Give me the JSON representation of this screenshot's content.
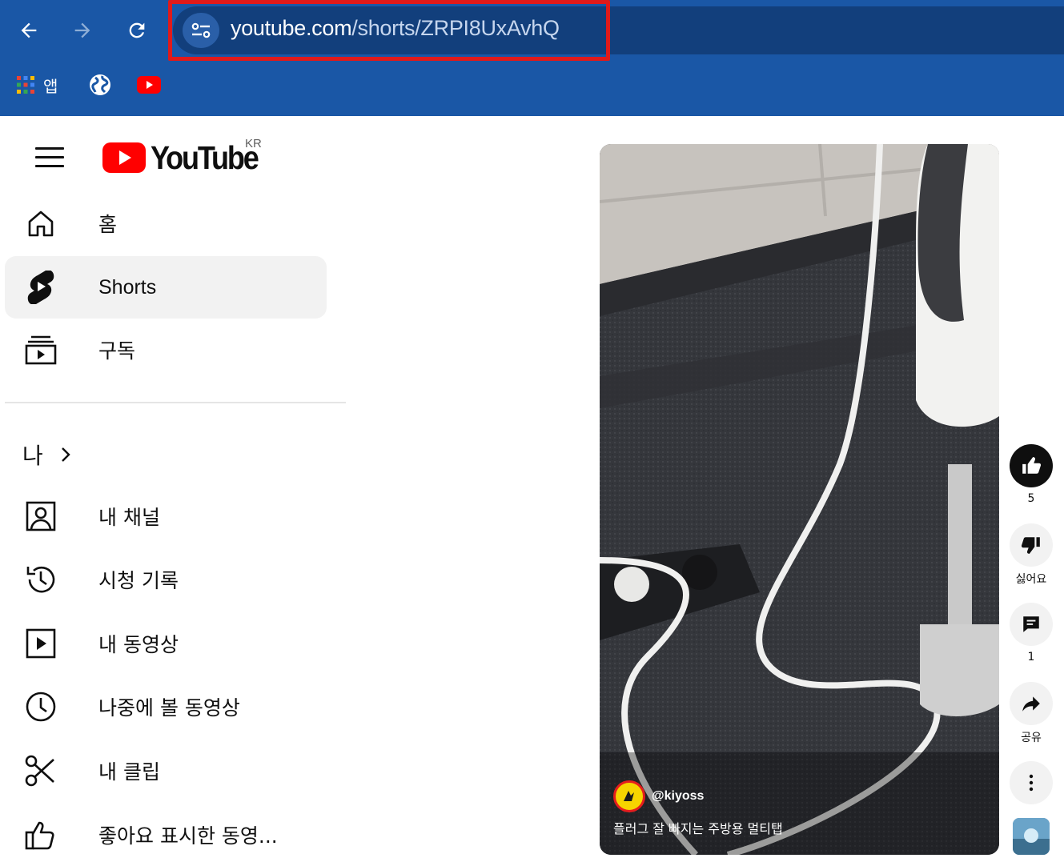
{
  "browser": {
    "url_host": "youtube.com",
    "url_path": "/shorts/ZRPI8UxAvhQ",
    "bookmarks": [
      {
        "icon": "apps-grid-icon",
        "label": "앱"
      },
      {
        "icon": "globe-icon",
        "label": ""
      },
      {
        "icon": "youtube-favicon-icon",
        "label": ""
      }
    ],
    "highlight_color": "#e01a1a",
    "chrome_color": "#1a57a6"
  },
  "youtube": {
    "logo_text": "YouTube",
    "region": "KR",
    "brand_red": "#ff0000",
    "nav": [
      {
        "label": "홈",
        "icon": "home-icon"
      },
      {
        "label": "Shorts",
        "icon": "shorts-icon",
        "active": true
      },
      {
        "label": "구독",
        "icon": "subscriptions-icon"
      }
    ],
    "you_section": {
      "title": "나",
      "items": [
        {
          "label": "내 채널",
          "icon": "account-box-icon"
        },
        {
          "label": "시청 기록",
          "icon": "history-icon"
        },
        {
          "label": "내 동영상",
          "icon": "video-play-icon"
        },
        {
          "label": "나중에 볼 동영상",
          "icon": "clock-icon"
        },
        {
          "label": "내 클립",
          "icon": "scissors-icon"
        },
        {
          "label": "좋아요 표시한 동영...",
          "icon": "thumbs-up-outline-icon"
        }
      ]
    }
  },
  "short": {
    "channel_handle": "@kiyoss",
    "title": "플러그 잘 빠지는 주방용 멀티탭",
    "actions": {
      "like_count": "5",
      "dislike_label": "싫어요",
      "comment_count": "1",
      "share_label": "공유"
    }
  }
}
